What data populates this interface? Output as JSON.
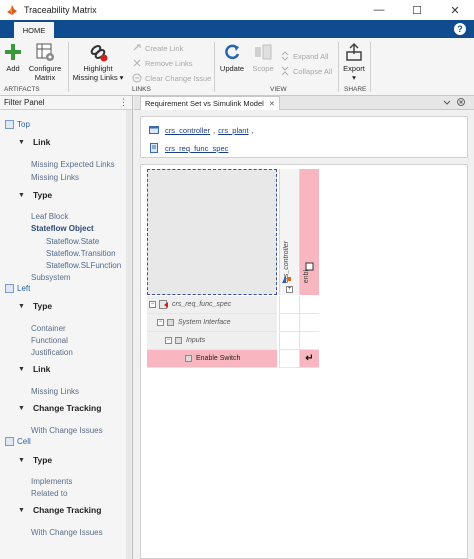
{
  "window": {
    "title": "Traceability Matrix",
    "minimize": "—",
    "maximize": "☐",
    "close": "✕"
  },
  "tabs": {
    "home": "HOME",
    "help": "?"
  },
  "ribbon": {
    "add": "Add",
    "configure_matrix": [
      "Configure",
      "Matrix"
    ],
    "highlight_missing_links": [
      "Highlight",
      "Missing Links ▾"
    ],
    "create_link": "Create Link",
    "remove_links": "Remove Links",
    "clear_change_issue": "Clear Change Issue",
    "update": "Update",
    "scope": "Scope",
    "expand_all": "Expand All",
    "collapse_all": "Collapse All",
    "export": [
      "Export",
      "▾"
    ],
    "sections": {
      "artifacts": "ARTIFACTS",
      "links": "LINKS",
      "view": "VIEW",
      "share": "SHARE"
    }
  },
  "filter_panel": {
    "title": "Filter Panel",
    "menu": "⋮",
    "top": "Top",
    "top_link": "Link",
    "missing_expected_links": "Missing Expected Links",
    "missing_links_1": "Missing Links",
    "top_type": "Type",
    "leaf_block": "Leaf Block",
    "stateflow_object": "Stateflow Object",
    "stateflow_state": "Stateflow.State",
    "stateflow_transition": "Stateflow.Transition",
    "stateflow_slfunction": "Stateflow.SLFunction",
    "subsystem": "Subsystem",
    "left": "Left",
    "left_type": "Type",
    "container": "Container",
    "functional": "Functional",
    "justification": "Justification",
    "left_link": "Link",
    "missing_links_2": "Missing Links",
    "change_tracking_1": "Change Tracking",
    "with_change_issues_1": "With Change Issues",
    "cell": "Cell",
    "cell_type": "Type",
    "implements": "Implements",
    "related_to": "Related to",
    "change_tracking_2": "Change Tracking",
    "with_change_issues_2": "With Change Issues"
  },
  "main": {
    "tab_label": "Requirement Set vs Simulink Model",
    "tab_close": "✕",
    "links": {
      "model_1": "crs_controller",
      "sep": ",",
      "model_2": "crs_plant",
      "sep2": ",",
      "req_set": "crs_req_func_spec"
    },
    "columns": [
      "crs_controller",
      "enbl"
    ],
    "rows": [
      {
        "label": "crs_req_func_spec",
        "exp": "−"
      },
      {
        "label": "System Interface",
        "exp": "−"
      },
      {
        "label": "Inputs",
        "exp": "−"
      },
      {
        "label": "Enable Switch",
        "exp": ""
      }
    ],
    "link_symbol": "↵"
  }
}
